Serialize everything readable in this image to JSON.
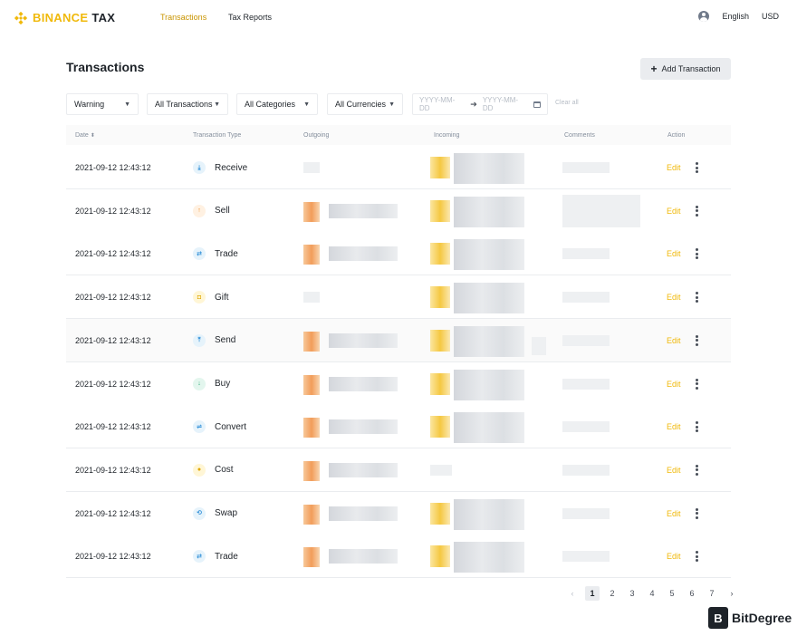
{
  "header": {
    "brand": "BINANCE",
    "brand_suffix": "TAX",
    "nav": [
      {
        "label": "Transactions",
        "active": true
      },
      {
        "label": "Tax Reports",
        "active": false
      }
    ],
    "language": "English",
    "currency": "USD"
  },
  "page": {
    "title": "Transactions",
    "add_button": "Add Transaction"
  },
  "filters": {
    "warning": "Warning",
    "transactions": "All Transactions",
    "categories": "All Categories",
    "currencies": "All Currencies",
    "date_from_placeholder": "YYYY-MM-DD",
    "date_to_placeholder": "YYYY-MM-DD",
    "clear_all": "Clear all"
  },
  "table": {
    "columns": [
      "Date",
      "Transaction Type",
      "Outgoing",
      "Incoming",
      "Comments",
      "Action"
    ],
    "rows": [
      {
        "date": "2021-09-12  12:43:12",
        "type": "Receive",
        "icon": "receive-icon",
        "action": "Edit"
      },
      {
        "date": "2021-09-12  12:43:12",
        "type": "Sell",
        "icon": "sell-icon",
        "action": "Edit"
      },
      {
        "date": "2021-09-12  12:43:12",
        "type": "Trade",
        "icon": "trade-icon",
        "action": "Edit"
      },
      {
        "date": "2021-09-12  12:43:12",
        "type": "Gift",
        "icon": "gift-icon",
        "action": "Edit"
      },
      {
        "date": "2021-09-12  12:43:12",
        "type": "Send",
        "icon": "send-icon",
        "action": "Edit"
      },
      {
        "date": "2021-09-12  12:43:12",
        "type": "Buy",
        "icon": "buy-icon",
        "action": "Edit"
      },
      {
        "date": "2021-09-12  12:43:12",
        "type": "Convert",
        "icon": "convert-icon",
        "action": "Edit"
      },
      {
        "date": "2021-09-12  12:43:12",
        "type": "Cost",
        "icon": "cost-icon",
        "action": "Edit"
      },
      {
        "date": "2021-09-12  12:43:12",
        "type": "Swap",
        "icon": "swap-icon",
        "action": "Edit"
      },
      {
        "date": "2021-09-12  12:43:12",
        "type": "Trade",
        "icon": "trade-icon",
        "action": "Edit"
      }
    ]
  },
  "pagination": {
    "pages": [
      "1",
      "2",
      "3",
      "4",
      "5",
      "6",
      "7"
    ],
    "current": "1",
    "prev": "‹",
    "next": "›"
  },
  "watermark": {
    "badge": "B",
    "text": "BitDegree"
  },
  "colors": {
    "brand_yellow": "#f0b90b",
    "active_nav": "#c99400",
    "text": "#1e2329"
  }
}
